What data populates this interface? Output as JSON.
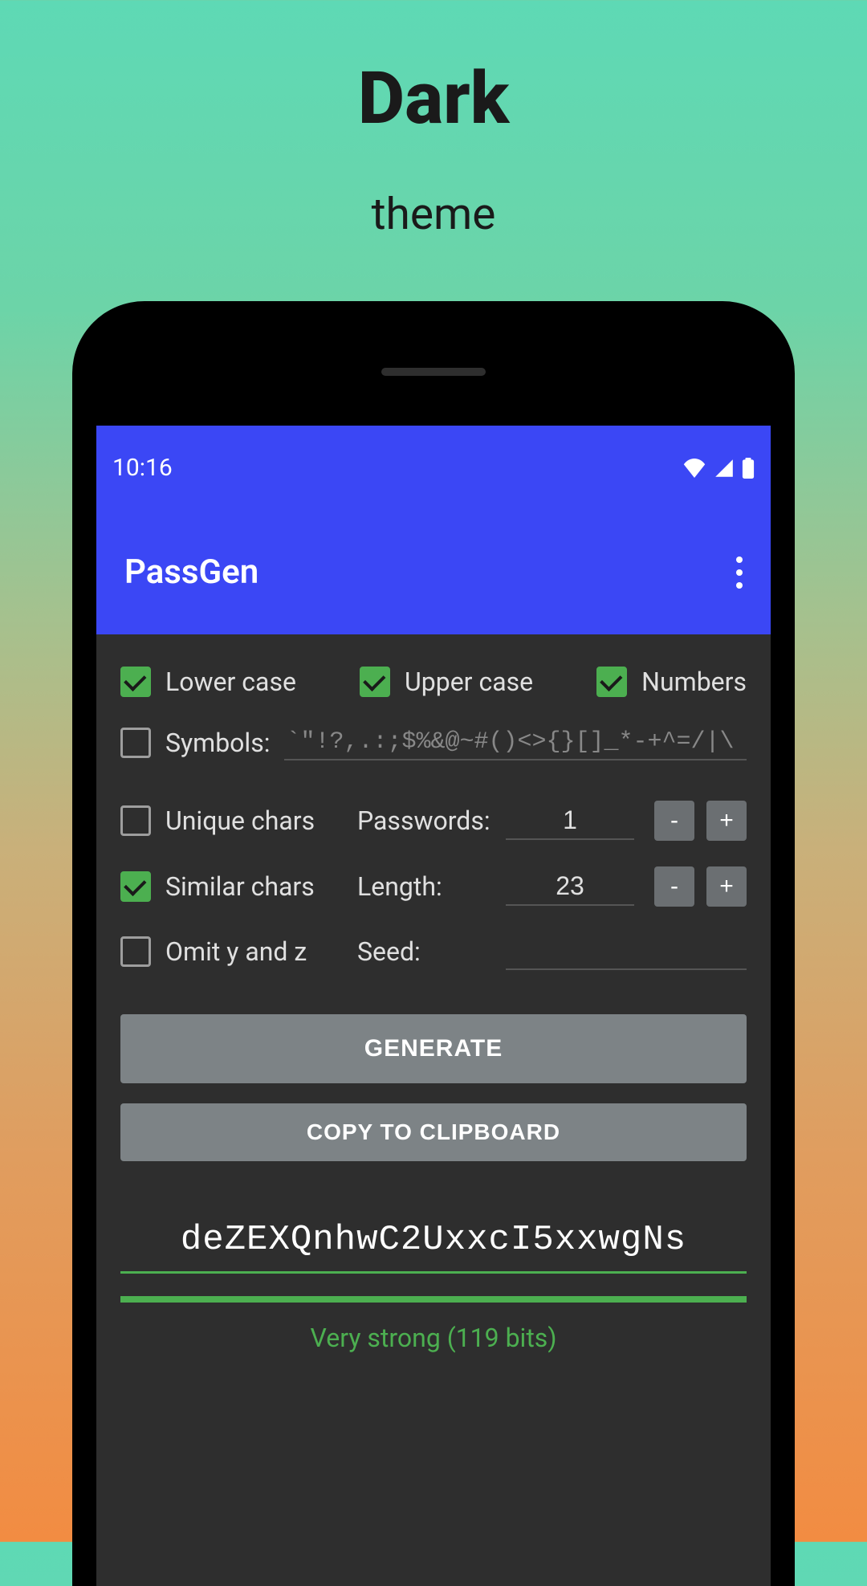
{
  "promo": {
    "title": "Dark",
    "subtitle": "theme"
  },
  "statusbar": {
    "time": "10:16"
  },
  "appbar": {
    "title": "PassGen"
  },
  "options": {
    "lowercase": {
      "label": "Lower case",
      "checked": true
    },
    "uppercase": {
      "label": "Upper case",
      "checked": true
    },
    "numbers": {
      "label": "Numbers",
      "checked": true
    },
    "symbols": {
      "label": "Symbols:",
      "checked": false,
      "value": "`\"!?,.:;$%&@~#()<>{}[]_*-+^=/|\\"
    },
    "unique": {
      "label": "Unique chars",
      "checked": false
    },
    "similar": {
      "label": "Similar chars",
      "checked": true
    },
    "omityz": {
      "label": "Omit y and z",
      "checked": false
    }
  },
  "fields": {
    "passwords": {
      "label": "Passwords:",
      "value": "1"
    },
    "length": {
      "label": "Length:",
      "value": "23"
    },
    "seed": {
      "label": "Seed:",
      "value": ""
    }
  },
  "buttons": {
    "generate": "GENERATE",
    "copy": "COPY TO CLIPBOARD",
    "minus": "-",
    "plus": "+"
  },
  "output": {
    "password": "deZEXQnhwC2UxxcI5xxwgNs",
    "strength": "Very strong (119 bits)"
  }
}
